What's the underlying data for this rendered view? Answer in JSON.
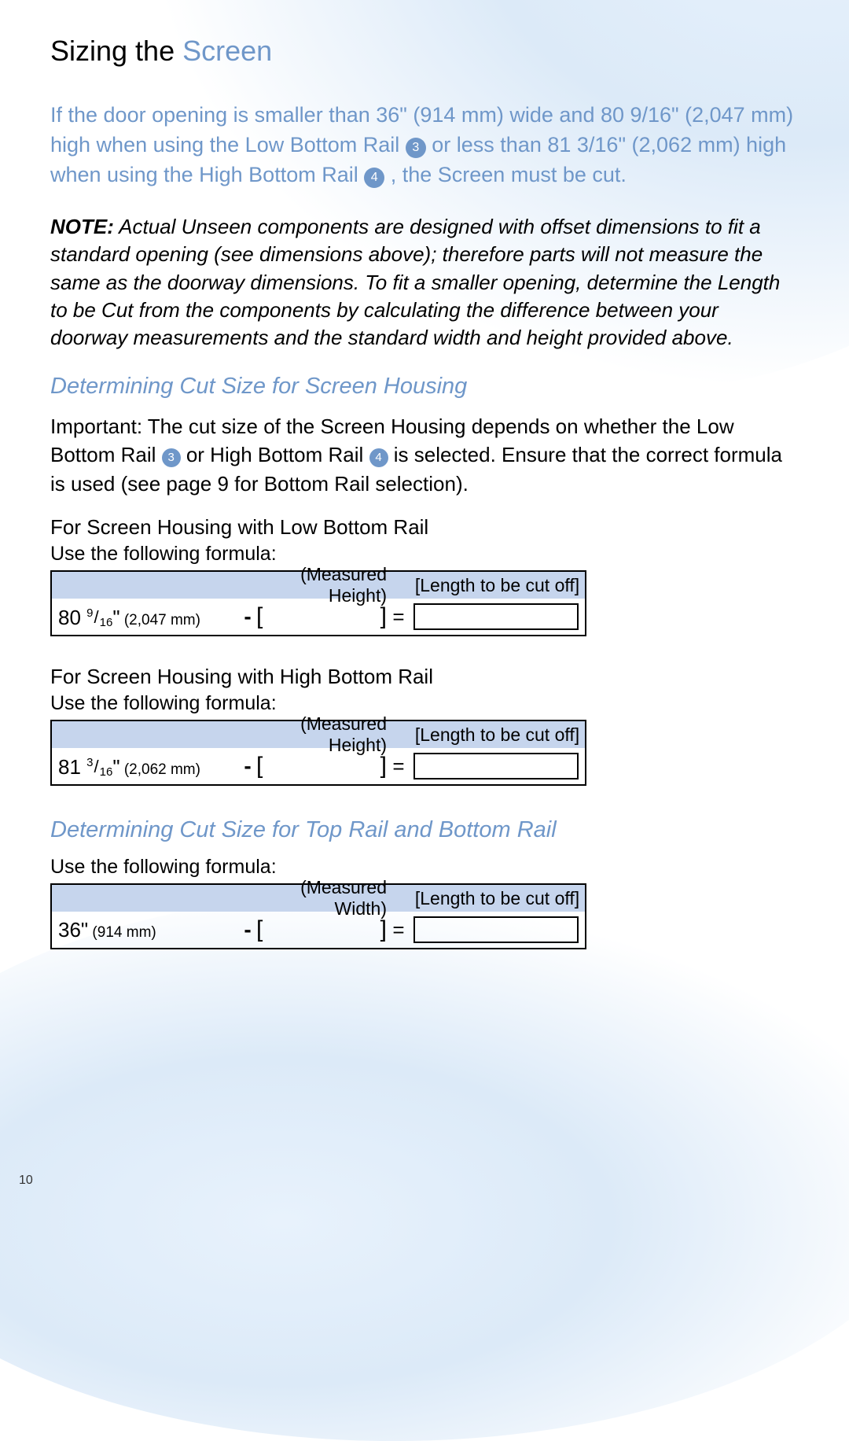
{
  "title_prefix": "Sizing the ",
  "title_accent": "Screen",
  "intro_parts": {
    "p1": "If the door opening is smaller than 36\" (914 mm) wide and 80 9/16\" (2,047 mm) high when using the Low Bottom Rail ",
    "badge3": "3",
    "p2": " or less than 81 3/16\" (2,062 mm) high when using the High Bottom Rail ",
    "badge4": "4",
    "p3": ", the Screen must be cut."
  },
  "note_label": "NOTE:",
  "note_body": " Actual Unseen components are designed with offset dimensions to fit a standard opening (see dimensions above); therefore parts will not measure the same as the doorway dimensions. To fit a smaller opening, determine the Length to be Cut from the components by calculating the difference between your doorway measurements and the standard width and height provided above.",
  "section1_heading": "Determining Cut Size for Screen Housing",
  "important": {
    "p1": "Important: The cut size of the Screen Housing depends on whether the Low Bottom Rail ",
    "b3": "3",
    "p2": " or High Bottom Rail ",
    "b4": "4",
    "p3": " is selected. Ensure that the correct formula is used (see page 9 for Bottom Rail selection)."
  },
  "formula_low": {
    "label_main": "For Screen Housing ",
    "label_light": "with Low Bottom Rail",
    "use_line": "Use the following formula:",
    "hdr_mid": "(Measured Height)",
    "hdr_right": "[Length to be cut off]",
    "const_whole": "80 ",
    "frac_num": "9",
    "frac_den": "16",
    "const_unit": "\"",
    "const_mm": " (2,047 mm)"
  },
  "formula_high": {
    "label_main": "For Screen Housing ",
    "label_light": "with High Bottom Rail",
    "use_line": "Use the following formula:",
    "hdr_mid": "(Measured Height)",
    "hdr_right": "[Length to be cut off]",
    "const_whole": "81 ",
    "frac_num": "3",
    "frac_den": "16",
    "const_unit": "\"",
    "const_mm": " (2,062 mm)"
  },
  "section2_heading": "Determining Cut Size for Top Rail and Bottom Rail",
  "formula_width": {
    "use_line": "Use the following formula:",
    "hdr_mid": "(Measured Width)",
    "hdr_right": "[Length to be cut off]",
    "const_whole": "36",
    "const_unit": "\"",
    "const_mm": " (914 mm)"
  },
  "symbols": {
    "minus": "-",
    "open_bracket": "[",
    "close_bracket": "]",
    "equals": "=",
    "slash": "/"
  },
  "page_number": "10"
}
